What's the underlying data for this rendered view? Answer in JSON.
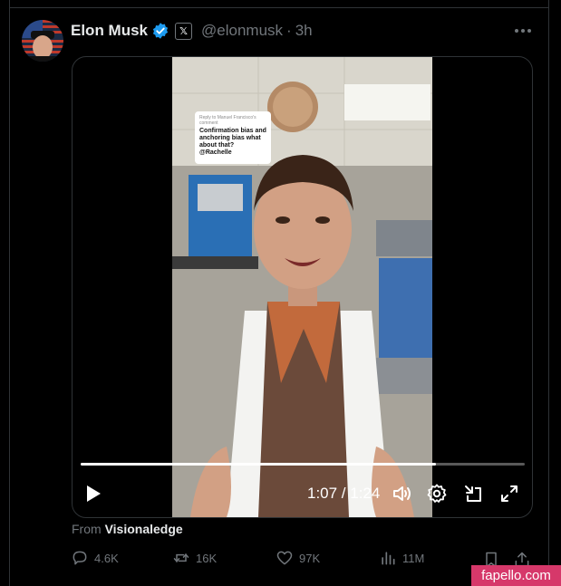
{
  "tweet": {
    "author_name": "Elon Musk",
    "handle": "@elonmusk",
    "separator": "·",
    "timestamp": "3h",
    "x_badge": "𝕏"
  },
  "video": {
    "caption_reply": "Reply to Manuel Francisco's comment",
    "caption_text": "Confirmation bias and anchoring bias what about that? @Rachelle",
    "current_time": "1:07",
    "duration": "1:24",
    "time_display": "1:07 / 1:24",
    "progress_fraction": 0.8
  },
  "source": {
    "prefix": "From",
    "name": "Visionaledge"
  },
  "actions": {
    "replies": "4.6K",
    "reposts": "16K",
    "likes": "97K",
    "views": "11M"
  },
  "watermark": "fapello.com",
  "colors": {
    "background": "#000000",
    "text_primary": "#e7e9ea",
    "text_secondary": "#71767b",
    "verified": "#1d9bf0",
    "watermark_bg": "#d6386a"
  }
}
